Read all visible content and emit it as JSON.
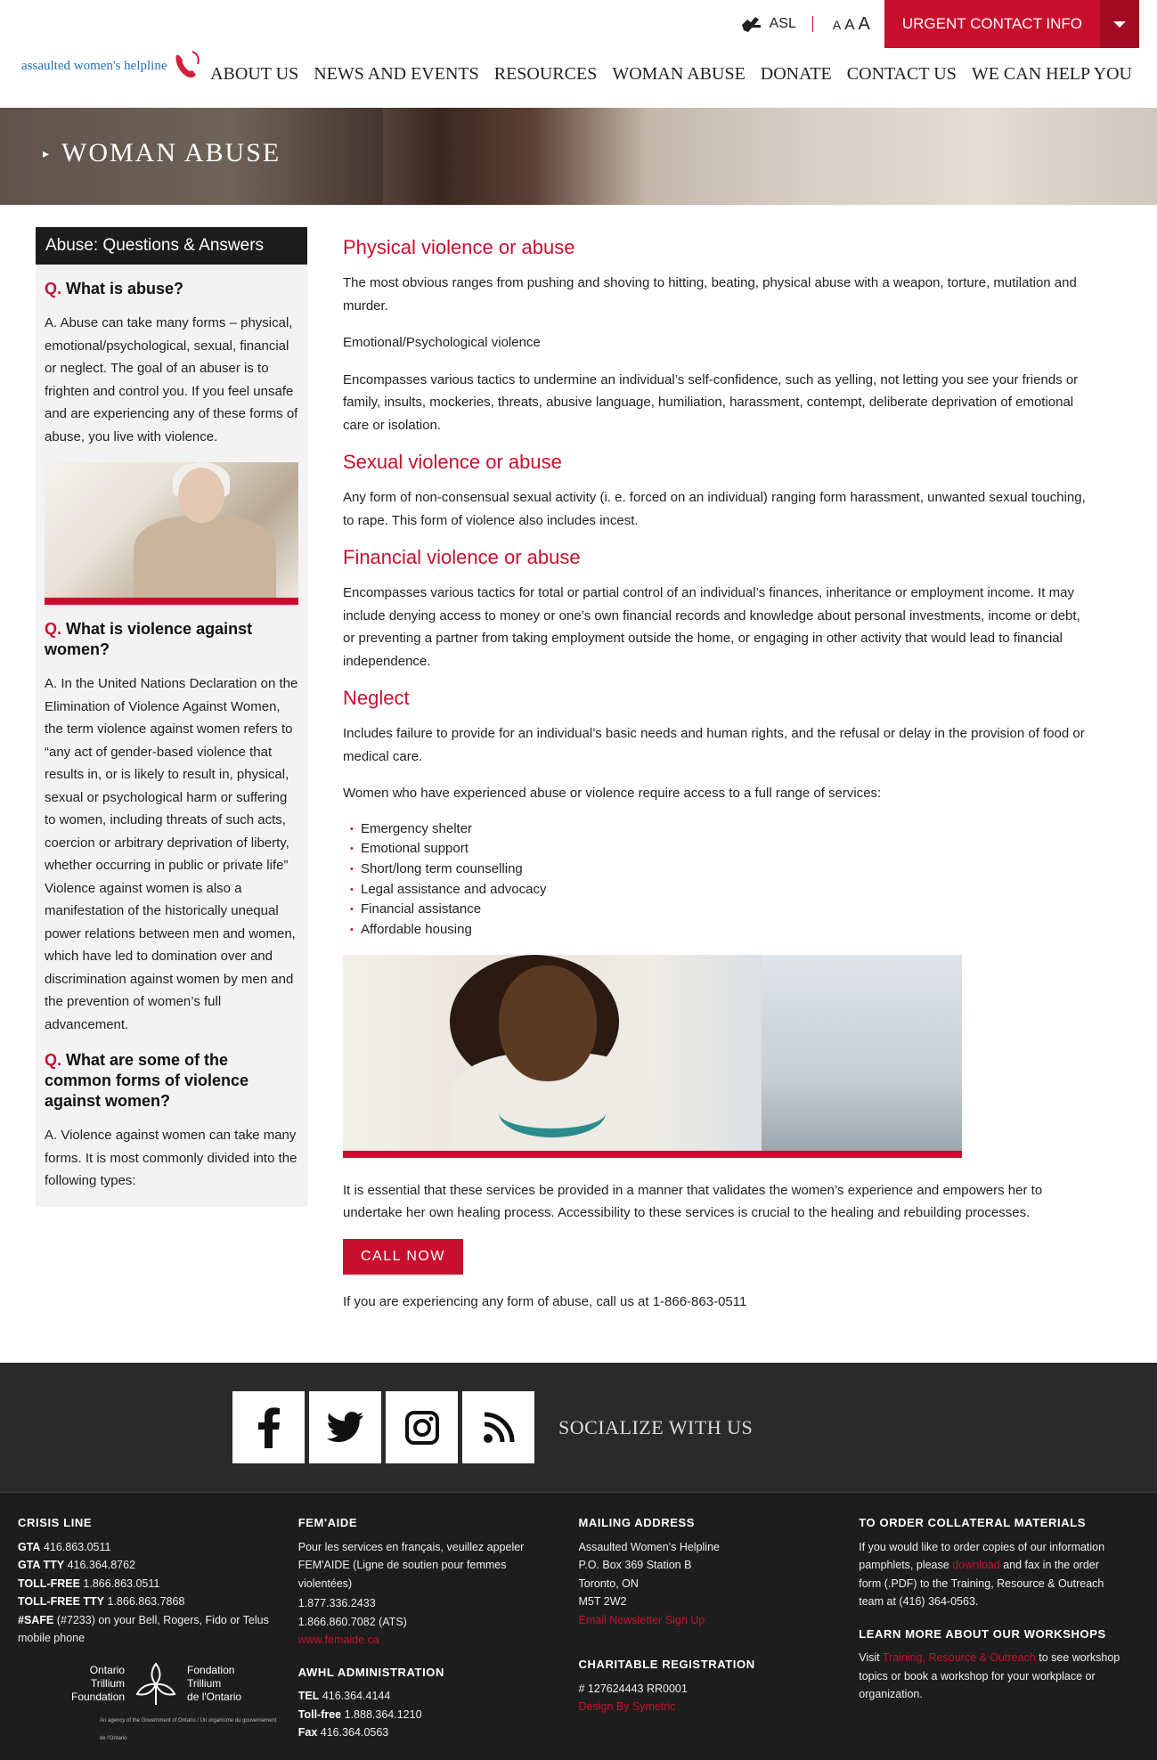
{
  "util": {
    "asl_label": "ASL",
    "text_sizes": [
      "A",
      "A",
      "A"
    ],
    "urgent_label": "URGENT CONTACT INFO"
  },
  "logo": {
    "text": "assaulted women's helpline"
  },
  "nav": [
    "ABOUT US",
    "NEWS AND EVENTS",
    "RESOURCES",
    "WOMAN ABUSE",
    "DONATE",
    "CONTACT US",
    "WE CAN HELP YOU"
  ],
  "banner": {
    "title": "WOMAN ABUSE"
  },
  "sidebar": {
    "title": "Abuse: Questions & Answers",
    "qa": [
      {
        "q_mark": "Q.",
        "q": "What is abuse?",
        "a": "A. Abuse can take many forms – physical, emotional/psychological, sexual, financial or neglect.  The goal of an abuser is to frighten and control you. If you feel unsafe and are experiencing any of these forms of abuse, you live with violence."
      },
      {
        "q_mark": "Q.",
        "q": "What is violence against women?",
        "a": "A. In the United Nations Declaration on the Elimination of Violence Against Women, the term violence against women refers to “any act of gender-based violence that results in, or is likely to result in, physical, sexual or psychological harm or suffering to women, including threats of such acts, coercion or arbitrary deprivation of liberty, whether occurring in public or private life” Violence against women is also a manifestation of the historically unequal power relations between men and women, which have led to domination over and discrimination against women by men and the prevention of women’s full advancement."
      },
      {
        "q_mark": "Q.",
        "q": "What are some of the common forms of violence against women?",
        "a": "A. Violence against women can take many forms. It is most commonly divided into the following types:"
      }
    ]
  },
  "main": {
    "physical_heading": "Physical violence or abuse",
    "physical_text": "The most obvious ranges from pushing and shoving to hitting, beating, physical abuse with a weapon, torture, mutilation and murder.",
    "emotional_label": "Emotional/Psychological violence",
    "emotional_text": "Encompasses various tactics to undermine an individual’s self-confidence, such as yelling, not letting you see your friends or family, insults, mockeries, threats, abusive language, humiliation, harassment, contempt, deliberate deprivation of emotional care or isolation.",
    "sexual_heading": "Sexual violence or abuse",
    "sexual_text": "Any form of non-consensual sexual activity (i. e. forced on an individual) ranging form harassment, unwanted sexual touching, to rape. This form of violence also includes incest.",
    "financial_heading": "Financial violence or abuse",
    "financial_text": "Encompasses various tactics for total or partial control of an individual’s finances, inheritance or employment income. It may include denying access to money or one’s own financial records and knowledge about personal investments, income or debt, or preventing a partner from taking employment outside the home, or engaging in other activity that would lead to financial independence.",
    "neglect_heading": "Neglect",
    "neglect_text": "Includes failure to provide for an individual’s basic needs and human rights, and the refusal or delay in the provision of food or medical care.",
    "services_intro": "Women who have experienced abuse or violence require access to a full range of services:",
    "services": [
      "Emergency shelter",
      "Emotional support",
      "Short/long term counselling",
      "Legal assistance and advocacy",
      "Financial assistance",
      "Affordable housing"
    ],
    "closing_text": "It is essential that these services be provided in a manner that validates the women’s experience and empowers her to undertake her own healing process.  Accessibility to these services is crucial to the healing and rebuilding processes.",
    "call_label": "CALL NOW",
    "call_text": "If you are experiencing any form of abuse, call us at 1-866-863-0511"
  },
  "social": {
    "label": "SOCIALIZE WITH US",
    "icons": [
      "facebook-icon",
      "twitter-icon",
      "instagram-icon",
      "rss-icon"
    ]
  },
  "footer": {
    "crisis": {
      "title": "CRISIS LINE",
      "lines": [
        {
          "k": "GTA",
          "v": "416.863.0511"
        },
        {
          "k": "GTA TTY",
          "v": "416.364.8762"
        },
        {
          "k": "TOLL-FREE",
          "v": "1.866.863.0511"
        },
        {
          "k": "TOLL-FREE TTY",
          "v": "1.866.863.7868"
        }
      ],
      "safe_k": "#SAFE",
      "safe_v": "(#7233) on your Bell, Rogers, Fido or Telus mobile phone",
      "trillium_left": [
        "Ontario",
        "Trillium",
        "Foundation"
      ],
      "trillium_right": [
        "Fondation",
        "Trillium",
        "de l'Ontario"
      ],
      "trillium_sub": "An agency of the Government of Ontario / Un organisme du gouvernement de l'Ontario"
    },
    "femaide": {
      "title": "FEM'AIDE",
      "text": "Pour les services en français, veuillez appeler FEM'AIDE (Ligne de soutien pour femmes violentées)",
      "phone1": "1.877.336.2433",
      "phone2": "1.866.860.7082 (ATS)",
      "link": "www.femaide.ca",
      "admin_title": "AWHL ADMINISTRATION",
      "admin": [
        {
          "k": "TEL",
          "v": "416.364.4144"
        },
        {
          "k": "Toll-free",
          "v": "1.888.364.1210"
        },
        {
          "k": "Fax",
          "v": "416.364.0563"
        }
      ]
    },
    "mailing": {
      "title": "MAILING ADDRESS",
      "lines": [
        "Assaulted Women's Helpline",
        "P.O. Box 369 Station B",
        "Toronto, ON",
        "M5T 2W2"
      ],
      "newsletter": "Email Newsletter Sign Up",
      "charity_title": "CHARITABLE REGISTRATION",
      "charity_no": "# 127624443 RR0001",
      "design": "Design By Symetric"
    },
    "collateral": {
      "title": "TO ORDER COLLATERAL MATERIALS",
      "pre": "If you would like to order copies of our information pamphlets, please",
      "link": "download",
      "post": "and fax in the order form (.PDF) to the Training, Resource & Outreach team at (416) 364-0563.",
      "workshops_title": "LEARN MORE ABOUT OUR WORKSHOPS",
      "ws_pre": "Visit",
      "ws_link": "Training, Resource & Outreach",
      "ws_post": "to see workshop topics or book a workshop for your workplace or organization."
    }
  }
}
